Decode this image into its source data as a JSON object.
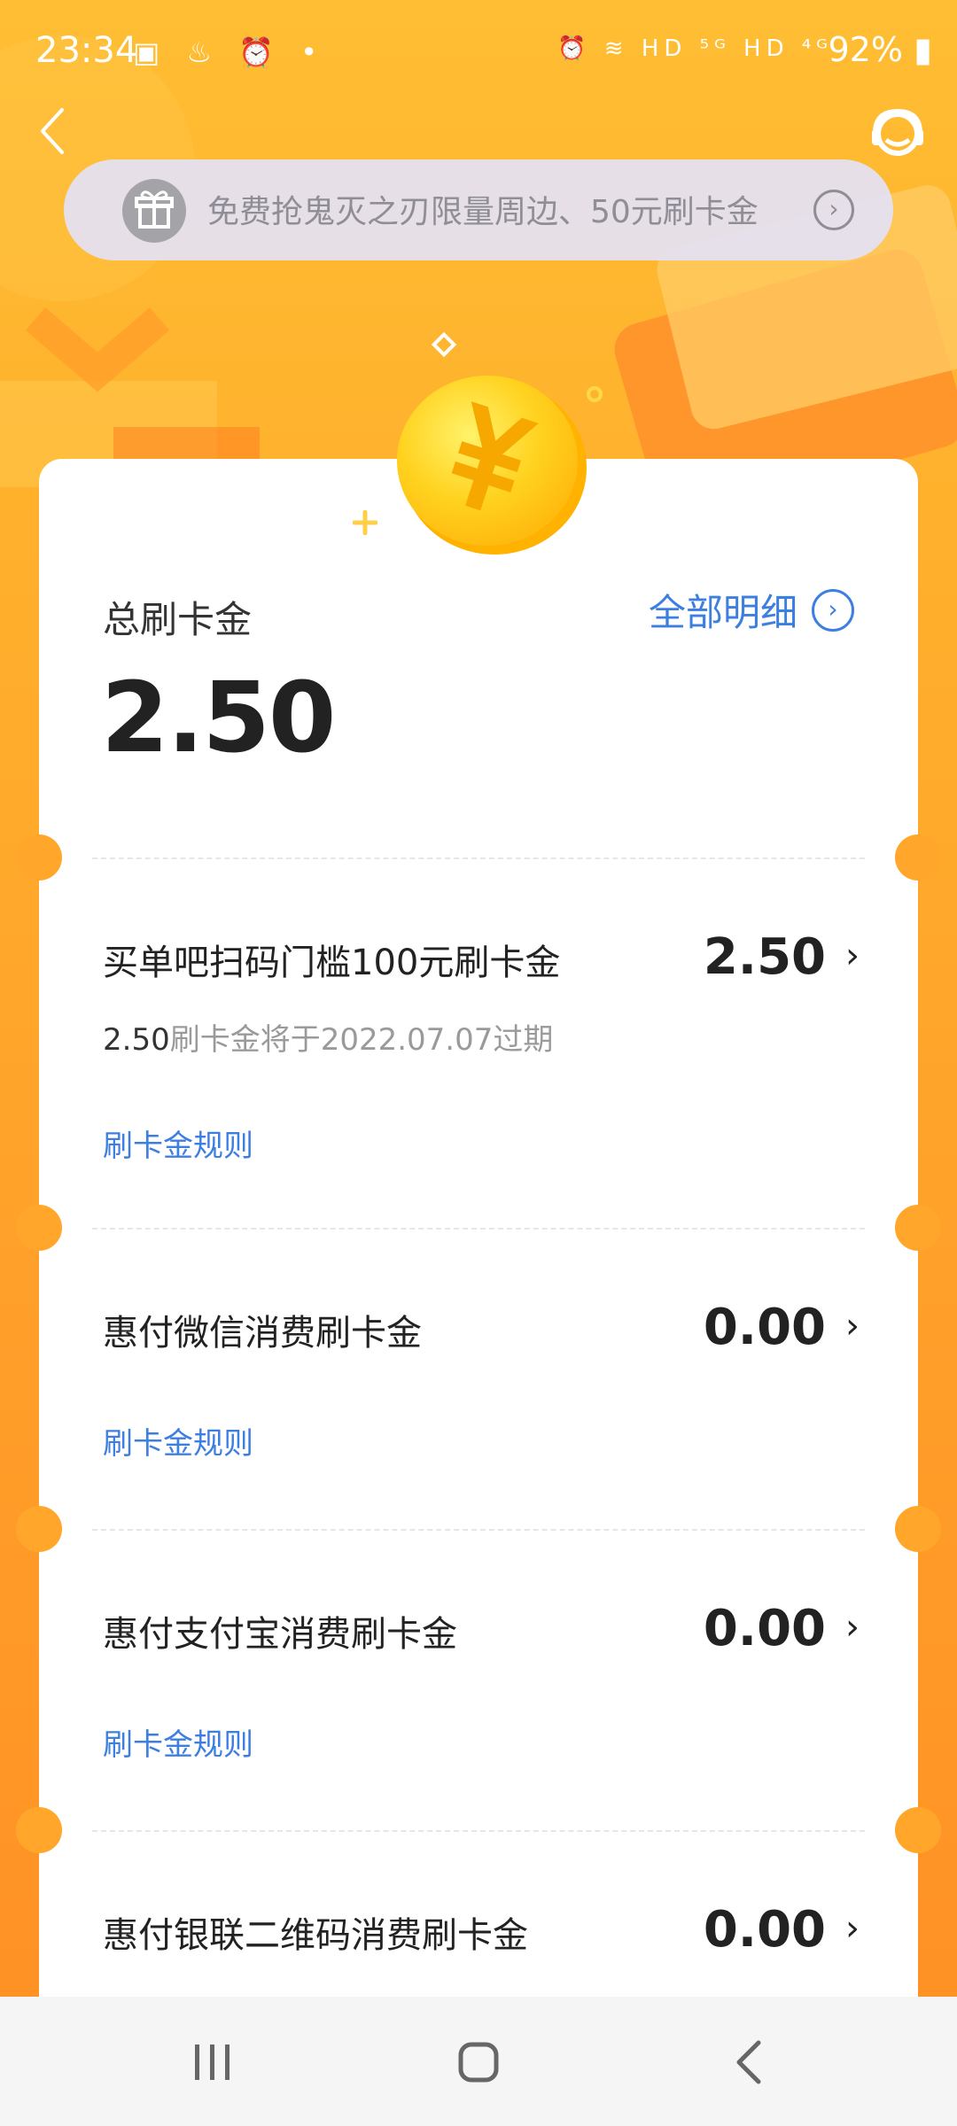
{
  "status_bar": {
    "time": "23:34",
    "battery": "92%",
    "signal_labels": "HD ⁵ᴳ HD ⁴ᴳ"
  },
  "banner": {
    "text": "免费抢鬼灭之刃限量周边、50元刷卡金",
    "gift_icon": "gift-icon",
    "arrow_icon": "chevron-right-circle-icon"
  },
  "summary": {
    "total_label": "总刷卡金",
    "total_value": "2.50",
    "detail_link": "全部明细"
  },
  "items": [
    {
      "title": "买单吧扫码门槛100元刷卡金",
      "amount": "2.50",
      "expire_amount": "2.50",
      "expire_text": "刷卡金将于2022.07.07过期",
      "rules": "刷卡金规则"
    },
    {
      "title": "惠付微信消费刷卡金",
      "amount": "0.00",
      "rules": "刷卡金规则"
    },
    {
      "title": "惠付支付宝消费刷卡金",
      "amount": "0.00",
      "rules": "刷卡金规则"
    },
    {
      "title": "惠付银联二维码消费刷卡金",
      "amount": "0.00"
    }
  ],
  "colors": {
    "background": "#ffa62b",
    "accent_blue": "#3d7fe0",
    "coin": "#ffd21f"
  }
}
